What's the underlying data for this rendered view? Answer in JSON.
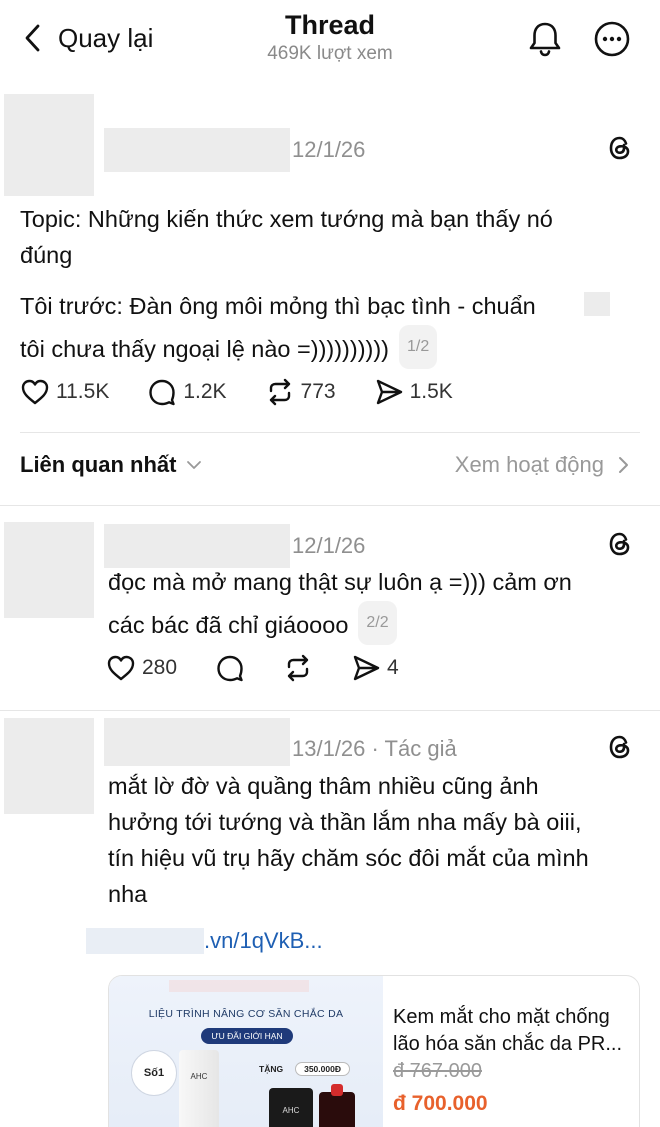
{
  "header": {
    "back_label": "Quay lại",
    "title": "Thread",
    "views": "469K lượt xem"
  },
  "post": {
    "date": "12/1/26",
    "line1": "Topic: Những kiến thức xem tướng mà bạn thấy nó",
    "line2": "đúng",
    "line3": "Tôi trước: Đàn ông môi mỏng thì bạc tình - chuẩn",
    "line4": "tôi chưa thấy ngoại lệ nào =))))))))))",
    "counter": "1/2",
    "likes": "11.5K",
    "comments": "1.2K",
    "reposts": "773",
    "shares": "1.5K"
  },
  "sort": {
    "label": "Liên quan nhất",
    "activity": "Xem hoạt động"
  },
  "reply1": {
    "date": "12/1/26",
    "line1": "đọc mà mở mang thật sự luôn ạ =))) cảm ơn",
    "line2": "các bác đã chỉ giáoooo",
    "counter": "2/2",
    "likes": "280",
    "shares": "4"
  },
  "reply2": {
    "date": "13/1/26 · Tác giả",
    "line1": "mắt lờ đờ và quầng thâm nhiều cũng ảnh",
    "line2": "hưởng tới tướng và thần lắm nha mấy bà oiii,",
    "line3": "tín hiệu vũ trụ hãy chăm sóc đôi mắt của mình",
    "line4": "nha",
    "link_text": ".vn/1qVkB...",
    "product": {
      "image_heading": "LIỆU TRÌNH NÂNG CƠ SĂN CHẮC DA",
      "image_pill": "ƯU ĐÃI GIỚI HẠN",
      "image_badge": "Số1",
      "image_gift": "TẶNG",
      "image_gift_value": "350.000Đ",
      "image_brand": "AHC",
      "name": "Kem mắt cho mặt chống lão hóa săn chắc da PR...",
      "old_price": "đ 767.000",
      "new_price": "đ 700.000"
    }
  },
  "colors": {
    "price": "#e8612c",
    "link": "#1e5fb3",
    "muted": "#8f8f8f"
  }
}
